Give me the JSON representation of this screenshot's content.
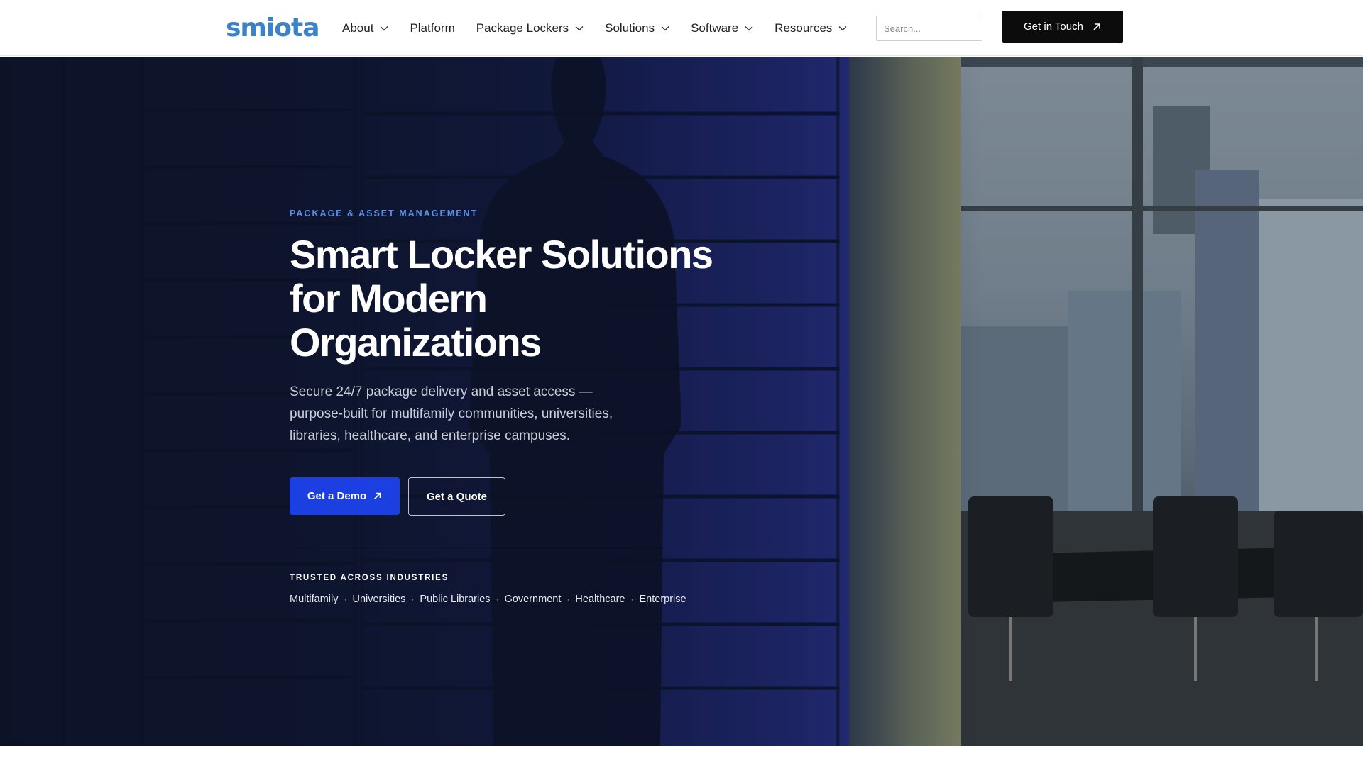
{
  "header": {
    "logo": "smiota",
    "nav": [
      {
        "label": "About",
        "dropdown": true
      },
      {
        "label": "Platform",
        "dropdown": false
      },
      {
        "label": "Package Lockers",
        "dropdown": true
      },
      {
        "label": "Solutions",
        "dropdown": true
      },
      {
        "label": "Software",
        "dropdown": true
      },
      {
        "label": "Resources",
        "dropdown": true
      }
    ],
    "search_placeholder": "Search...",
    "cta": "Get in Touch"
  },
  "hero": {
    "eyebrow": "PACKAGE & ASSET MANAGEMENT",
    "headline": "Smart Locker Solutions for Modern Organizations",
    "subtext": "Secure 24/7 package delivery and asset access — purpose-built for multifamily communities, universities, libraries, healthcare, and enterprise campuses.",
    "primary_button": "Get a Demo",
    "secondary_button": "Get a Quote",
    "trusted_title": "TRUSTED ACROSS INDUSTRIES",
    "industries": [
      "Multifamily",
      "Universities",
      "Public Libraries",
      "Government",
      "Healthcare",
      "Enterprise"
    ]
  },
  "colors": {
    "logo": "#3a83c9",
    "primary_button": "#1b3fe0",
    "eyebrow": "#5b8fe6",
    "header_cta": "#0c0c0c"
  },
  "icons": {
    "nav_dropdown": "chevron-down-icon",
    "cta_arrow": "arrow-up-right-icon"
  }
}
